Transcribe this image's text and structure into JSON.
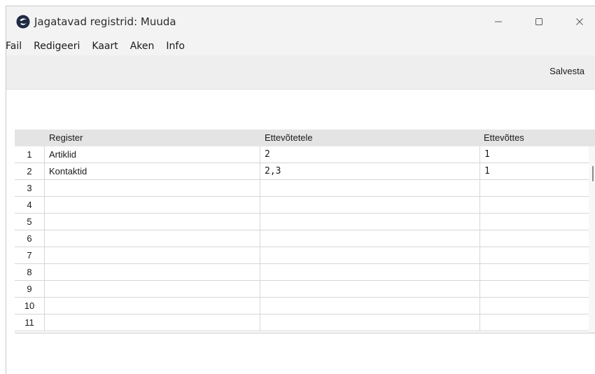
{
  "window": {
    "title": "Jagatavad registrid: Muuda",
    "controls": {
      "minimize": "—",
      "maximize": "☐",
      "close": "✕"
    }
  },
  "menu": [
    "Fail",
    "Redigeeri",
    "Kaart",
    "Aken",
    "Info"
  ],
  "toolbar": {
    "save_label": "Salvesta"
  },
  "table": {
    "columns": [
      "Register",
      "Ettevõtetele",
      "Ettevõttes"
    ],
    "rows": [
      {
        "num": "1",
        "register": "Artiklid",
        "ettevotetele": "2",
        "ettevottes": "1"
      },
      {
        "num": "2",
        "register": "Kontaktid",
        "ettevotetele": "2,3",
        "ettevottes": "1"
      },
      {
        "num": "3",
        "register": "",
        "ettevotetele": "",
        "ettevottes": ""
      },
      {
        "num": "4",
        "register": "",
        "ettevotetele": "",
        "ettevottes": ""
      },
      {
        "num": "5",
        "register": "",
        "ettevotetele": "",
        "ettevottes": ""
      },
      {
        "num": "6",
        "register": "",
        "ettevotetele": "",
        "ettevottes": ""
      },
      {
        "num": "7",
        "register": "",
        "ettevotetele": "",
        "ettevottes": ""
      },
      {
        "num": "8",
        "register": "",
        "ettevotetele": "",
        "ettevottes": ""
      },
      {
        "num": "9",
        "register": "",
        "ettevotetele": "",
        "ettevottes": ""
      },
      {
        "num": "10",
        "register": "",
        "ettevotetele": "",
        "ettevottes": ""
      },
      {
        "num": "11",
        "register": "",
        "ettevotetele": "",
        "ettevottes": ""
      }
    ]
  },
  "icons": {
    "app": "app-logo-icon",
    "minimize": "minimize-icon",
    "maximize": "maximize-icon",
    "close": "close-icon"
  }
}
